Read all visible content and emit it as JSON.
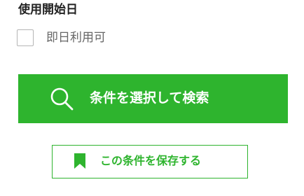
{
  "filter": {
    "title": "使用開始日",
    "immediate_option": {
      "label": "即日利用可",
      "checked": false
    }
  },
  "actions": {
    "search_label": "条件を選択して検索",
    "save_label": "この条件を保存する",
    "search_icon": "search-icon",
    "save_icon": "bookmark-icon"
  },
  "colors": {
    "accent": "#2eb42e",
    "button_text": "#ffffff",
    "title_text": "#222222",
    "label_text": "#666666",
    "checkbox_border": "#b5b5b5"
  }
}
